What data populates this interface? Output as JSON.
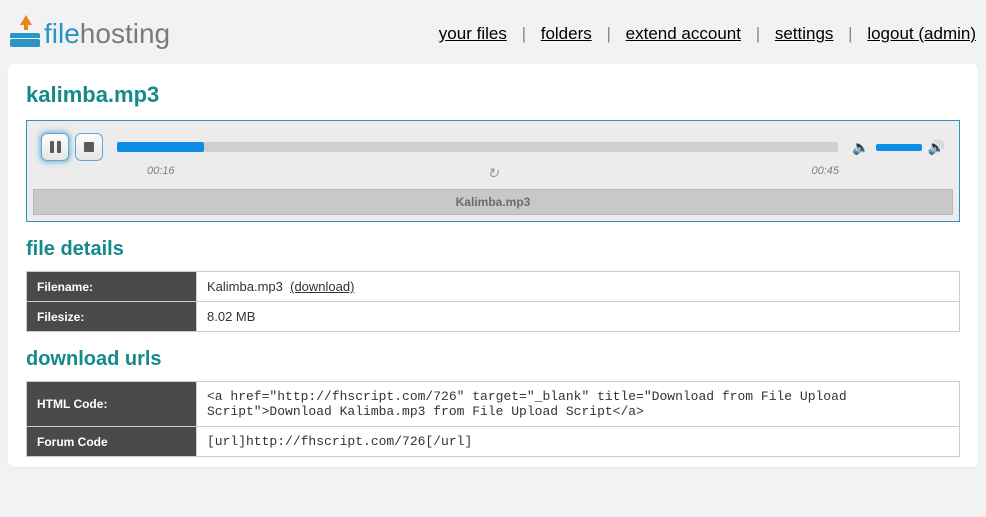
{
  "brand": {
    "word1": "file",
    "word2": "hosting"
  },
  "nav": {
    "your_files": "your files",
    "folders": "folders",
    "extend": "extend account",
    "settings": "settings",
    "logout": "logout (admin)"
  },
  "page_title": "kalimba.mp3",
  "player": {
    "elapsed": "00:16",
    "total": "00:45",
    "progress_pct": "12%",
    "title": "Kalimba.mp3"
  },
  "details": {
    "heading": "file details",
    "filename_label": "Filename:",
    "filename": "Kalimba.mp3",
    "download_link": "(download)",
    "filesize_label": "Filesize:",
    "filesize": "8.02 MB"
  },
  "urls": {
    "heading": "download urls",
    "html_label": "HTML Code:",
    "html_code": "<a href=\"http://fhscript.com/726\" target=\"_blank\" title=\"Download from File Upload Script\">Download Kalimba.mp3 from File Upload Script</a>",
    "forum_label": "Forum Code",
    "forum_code": "[url]http://fhscript.com/726[/url]"
  }
}
